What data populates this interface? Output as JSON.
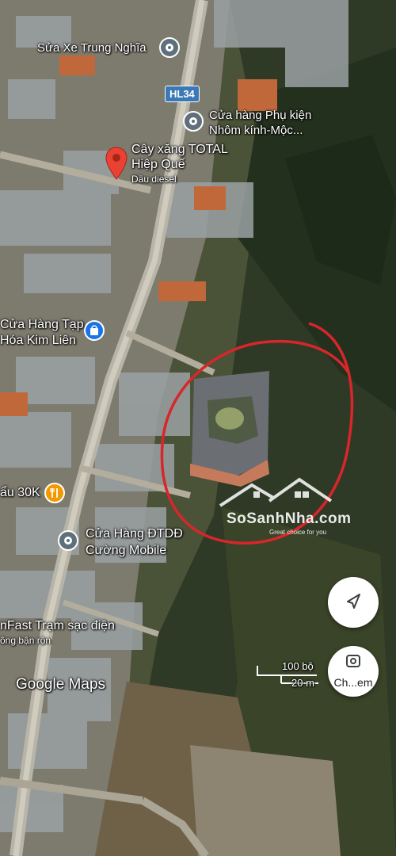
{
  "road_badge": "HL34",
  "places": {
    "sua_xe": "Sửa Xe Trung Nghĩa",
    "cua_hang_phu_kien_1": "Cửa hàng Phụ kiện",
    "cua_hang_phu_kien_2": "Nhôm kính-Mộc...",
    "cay_xang_1": "Cây xăng TOTAL",
    "cay_xang_2": "Hiệp Quế",
    "cay_xang_sub": "Dầu diesel",
    "tap_hoa_1": "Cửa Hàng Tạp",
    "tap_hoa_2": "Hóa Kim Liên",
    "lau": "ẩu 30K",
    "dtdd_1": "Cửa Hàng ĐTDĐ",
    "dtdd_2": "Cường Mobile",
    "tram_sac_1": "nFast Trạm sạc điện",
    "tram_sac_2": "ông bận rộn"
  },
  "watermark": {
    "name": "SoSanhNha.com",
    "tagline": "Great choice for you"
  },
  "attribution": "Google Maps",
  "scale": {
    "imperial": "100 bộ",
    "metric": "20 m"
  },
  "buttons": {
    "lens_label": "Ch...em"
  },
  "icons": [
    "direction-arrow-icon",
    "camera-lens-icon",
    "fuel-pin-icon",
    "shopping-bag-icon",
    "restaurant-icon",
    "place-marker-icon"
  ],
  "colors": {
    "pin_red": "#e94235",
    "badge_blue": "#3b78b6",
    "shop_blue": "#1a73e8",
    "food_orange": "#f29900",
    "circle_red": "#d8262b"
  }
}
